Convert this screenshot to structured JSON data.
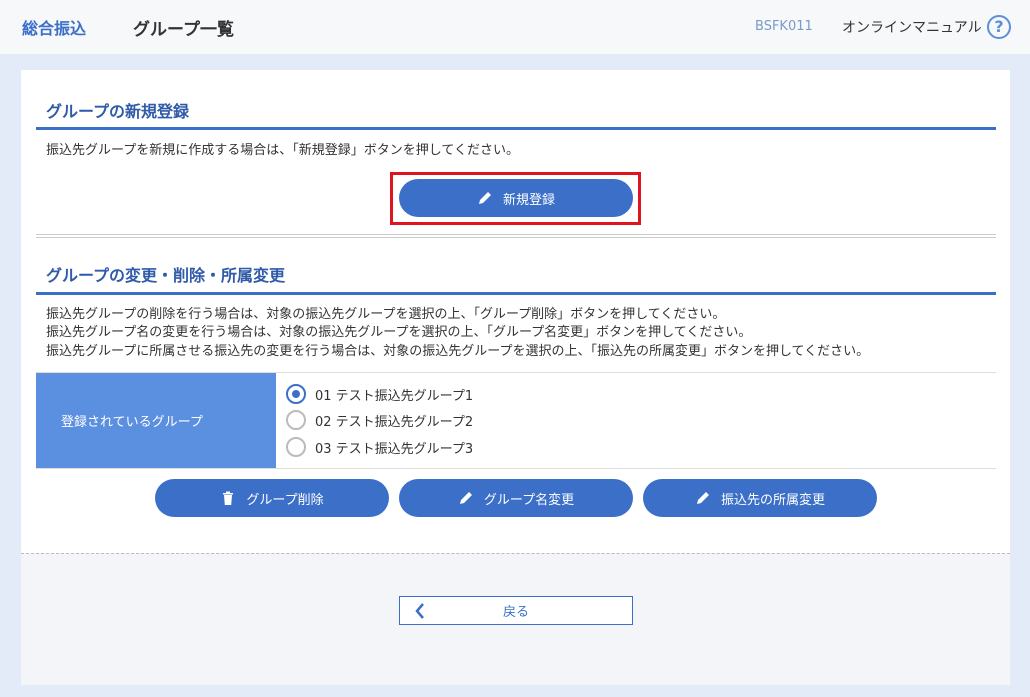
{
  "header": {
    "app_name": "総合振込",
    "page_title": "グループ一覧",
    "screen_id": "BSFK011",
    "manual_link": "オンラインマニュアル",
    "help_glyph": "?"
  },
  "new_section": {
    "title": "グループの新規登録",
    "description": "振込先グループを新規に作成する場合は、「新規登録」ボタンを押してください。",
    "new_button": "新規登録"
  },
  "edit_section": {
    "title": "グループの変更・削除・所属変更",
    "descriptions": [
      "振込先グループの削除を行う場合は、対象の振込先グループを選択の上、「グループ削除」ボタンを押してください。",
      "振込先グループ名の変更を行う場合は、対象の振込先グループを選択の上、「グループ名変更」ボタンを押してください。",
      "振込先グループに所属させる振込先の変更を行う場合は、対象の振込先グループを選択の上、「振込先の所属変更」ボタンを押してください。"
    ],
    "group_label": "登録されているグループ",
    "groups": [
      {
        "label": "01 テスト振込先グループ1",
        "selected": true
      },
      {
        "label": "02 テスト振込先グループ2",
        "selected": false
      },
      {
        "label": "03 テスト振込先グループ3",
        "selected": false
      }
    ],
    "delete_button": "グループ削除",
    "rename_button": "グループ名変更",
    "membership_button": "振込先の所属変更"
  },
  "footer": {
    "back_button": "戻る"
  },
  "colors": {
    "accent": "#3b6fc8",
    "label_cell": "#5b8fe0",
    "highlight": "#e0141e"
  },
  "icons": {
    "help": "help-circle-icon",
    "new": "pencil-icon",
    "delete": "trash-icon",
    "rename": "pencil-icon",
    "membership": "pencil-icon",
    "back": "chevron-left-icon"
  }
}
